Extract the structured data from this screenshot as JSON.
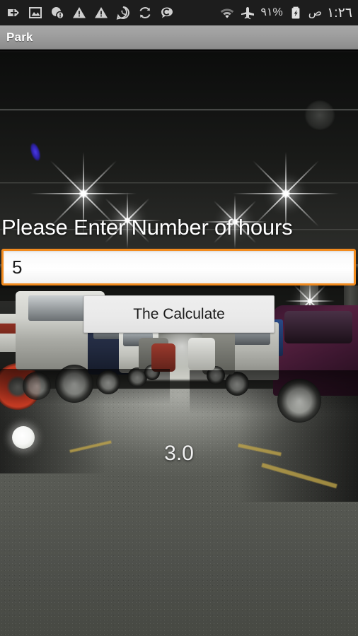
{
  "status_bar": {
    "left_icons": [
      {
        "name": "sd-card-add-icon",
        "glyph": "sd-add"
      },
      {
        "name": "screenshot-icon",
        "glyph": "image"
      },
      {
        "name": "app-alert-icon",
        "glyph": "dot-alert"
      },
      {
        "name": "warning-icon",
        "glyph": "warning"
      },
      {
        "name": "warning-icon-2",
        "glyph": "warning"
      },
      {
        "name": "whatsapp-icon",
        "glyph": "whatsapp"
      },
      {
        "name": "sync-icon",
        "glyph": "sync"
      },
      {
        "name": "chat-icon",
        "glyph": "chat-c"
      }
    ],
    "wifi_icon": "wifi-icon",
    "airplane_icon": "airplane-mode-icon",
    "battery_percent": "٩١%",
    "battery_icon": "battery-charging-icon",
    "am_pm": "ص",
    "clock": "١:٢٦"
  },
  "action_bar": {
    "title": "Park"
  },
  "main": {
    "hours_label": "Please Enter Number of hours",
    "hours_input_value": "5",
    "hours_input_placeholder": "",
    "calculate_button_label": "The Calculate",
    "result_value": "3.0"
  },
  "colors": {
    "input_focus_border": "#f28b1e",
    "action_bar_top": "#a8a8a8",
    "action_bar_bottom": "#8c8c8c",
    "button_face": "#eaeaea",
    "text_on_photo": "#ffffff",
    "status_bar_bg": "#1d1d1d"
  }
}
